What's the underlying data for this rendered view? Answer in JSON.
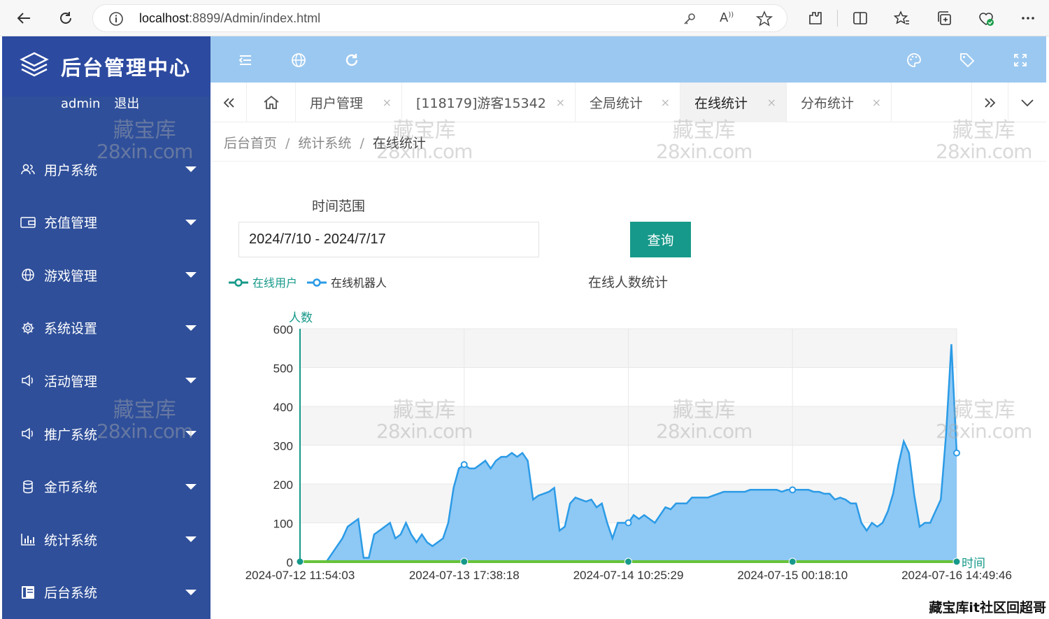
{
  "browser": {
    "url_host": "localhost",
    "url_rest": ":8899/Admin/index.html"
  },
  "sidebar": {
    "title": "后台管理中心",
    "user": "admin",
    "logout": "退出",
    "items": [
      {
        "label": "用户系统",
        "icon": "users-icon"
      },
      {
        "label": "充值管理",
        "icon": "wallet-icon"
      },
      {
        "label": "游戏管理",
        "icon": "globe-icon"
      },
      {
        "label": "系统设置",
        "icon": "gear-icon"
      },
      {
        "label": "活动管理",
        "icon": "speaker-icon"
      },
      {
        "label": "推广系统",
        "icon": "speaker-icon"
      },
      {
        "label": "金币系统",
        "icon": "database-icon"
      },
      {
        "label": "统计系统",
        "icon": "bar-chart-icon"
      },
      {
        "label": "后台系统",
        "icon": "book-icon"
      }
    ]
  },
  "tabs": [
    {
      "label": "用户管理",
      "active": false
    },
    {
      "label": "[118179]游客15342",
      "active": false
    },
    {
      "label": "全局统计",
      "active": false
    },
    {
      "label": "在线统计",
      "active": true
    },
    {
      "label": "分布统计",
      "active": false
    }
  ],
  "breadcrumb": {
    "home": "后台首页",
    "section": "统计系统",
    "current": "在线统计",
    "sep": "/"
  },
  "form": {
    "time_label": "时间范围",
    "date_range": "2024/7/10 - 2024/7/17",
    "query_label": "查询"
  },
  "watermark": {
    "line1": "藏宝库",
    "line2": "28xin.com",
    "corner": "藏宝库it社区回超哥"
  },
  "colors": {
    "sidebar": "#2f4f9a",
    "topbar": "#9bc8f0",
    "accent": "#16998a",
    "series_user": "#16998a",
    "series_robot": "#2b9be6"
  },
  "chart_data": {
    "type": "area",
    "title": "在线人数统计",
    "ylabel": "人数",
    "xlabel": "时间",
    "ylim": [
      0,
      600
    ],
    "yticks": [
      0,
      100,
      200,
      300,
      400,
      500,
      600
    ],
    "xtick_labels": [
      "2024-07-12 11:54:03",
      "2024-07-13 17:38:18",
      "2024-07-14 10:25:29",
      "2024-07-15 00:18:10",
      "2024-07-16 14:49:46"
    ],
    "legend": [
      "在线用户",
      "在线机器人"
    ],
    "legend_position": "top-left",
    "grid": true,
    "series": [
      {
        "name": "在线用户",
        "values": [
          0,
          0,
          0,
          0,
          0,
          0,
          0,
          0,
          0,
          0,
          0,
          0,
          0,
          0,
          0,
          0,
          0,
          0,
          0,
          0,
          0,
          0,
          0,
          0,
          0,
          0,
          0,
          0,
          0,
          0,
          0,
          0,
          0,
          0,
          0,
          0,
          0,
          0,
          0,
          0,
          0,
          0,
          0,
          0,
          0,
          0,
          0,
          0,
          0,
          0,
          0,
          0,
          0,
          0,
          0,
          0,
          0,
          0,
          0,
          0,
          0,
          0,
          0,
          0,
          0,
          0,
          0,
          0,
          0,
          0,
          0,
          0,
          0,
          0,
          0,
          0,
          0,
          0,
          0,
          0,
          0,
          0,
          0,
          0,
          0,
          0,
          0,
          0,
          0,
          0,
          0,
          0,
          0,
          0,
          0,
          0,
          0,
          0,
          0,
          0,
          0,
          0,
          0,
          0,
          0,
          0,
          0,
          0,
          0,
          0,
          0,
          0,
          0,
          0,
          0,
          0,
          0,
          0,
          0,
          0,
          0
        ]
      },
      {
        "name": "在线机器人",
        "values": [
          0,
          0,
          0,
          0,
          0,
          0,
          20,
          40,
          60,
          90,
          100,
          110,
          10,
          10,
          70,
          80,
          90,
          100,
          60,
          70,
          100,
          70,
          50,
          70,
          50,
          40,
          50,
          60,
          100,
          190,
          240,
          250,
          240,
          240,
          250,
          260,
          240,
          260,
          270,
          270,
          280,
          270,
          280,
          260,
          160,
          170,
          175,
          180,
          190,
          80,
          90,
          150,
          165,
          160,
          155,
          160,
          140,
          150,
          100,
          60,
          100,
          100,
          100,
          120,
          110,
          120,
          110,
          100,
          120,
          140,
          135,
          150,
          150,
          150,
          165,
          165,
          165,
          165,
          170,
          175,
          180,
          180,
          180,
          180,
          180,
          185,
          185,
          185,
          185,
          185,
          185,
          180,
          185,
          185,
          185,
          185,
          185,
          180,
          180,
          175,
          175,
          160,
          165,
          160,
          150,
          150,
          100,
          80,
          100,
          90,
          100,
          130,
          175,
          250,
          310,
          280,
          170,
          90,
          100,
          100,
          130,
          160,
          330,
          560,
          280
        ]
      }
    ]
  }
}
